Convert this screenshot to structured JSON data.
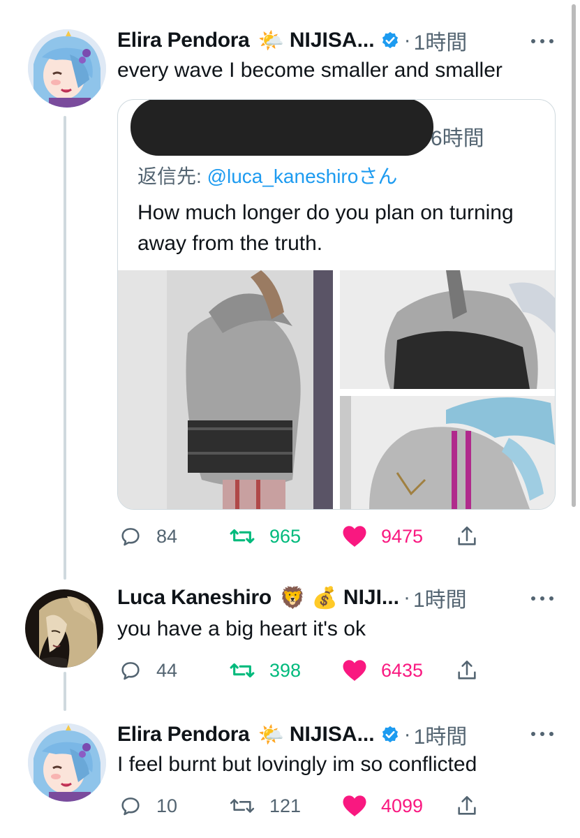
{
  "tweets": [
    {
      "author": "Elira Pendora",
      "badges": "🌤️",
      "handle_name": "NIJISA...",
      "time": "1時間",
      "text": "every wave I become smaller and smaller",
      "quote": {
        "time": "6時間",
        "reply_prefix": "返信先: ",
        "reply_mention": "@luca_kaneshiro",
        "reply_suffix": "さん",
        "text": "How much longer do you plan on turning away from the truth."
      },
      "stats": {
        "replies": "84",
        "retweets": "965",
        "likes": "9475"
      }
    },
    {
      "author": "Luca Kaneshiro",
      "badges": "🦁 💰",
      "handle_name": "NIJI...",
      "time": "1時間",
      "text": "you have a big heart it's ok",
      "stats": {
        "replies": "44",
        "retweets": "398",
        "likes": "6435"
      }
    },
    {
      "author": "Elira Pendora",
      "badges": "🌤️",
      "handle_name": "NIJISA...",
      "time": "1時間",
      "text": "I feel burnt but lovingly im so conflicted",
      "stats": {
        "replies": "10",
        "retweets": "121",
        "likes": "4099"
      }
    }
  ],
  "colors": {
    "accent": "#1d9bf0",
    "retweet": "#00ba7c",
    "like": "#f91880",
    "muted": "#536471"
  }
}
